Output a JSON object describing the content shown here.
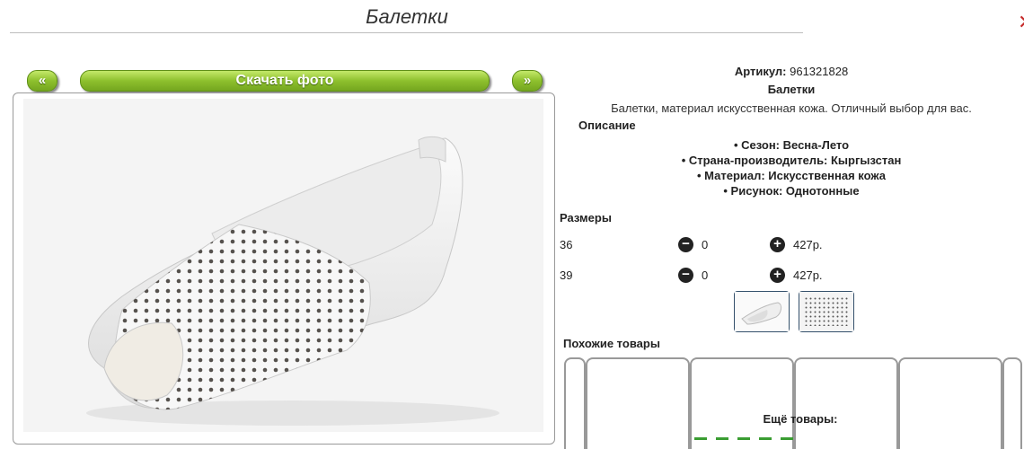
{
  "page": {
    "title": "Балетки"
  },
  "nav": {
    "prev_label": "«",
    "download_label": "Скачать фото",
    "next_label": "»"
  },
  "product": {
    "article_label": "Артикул:",
    "article_value": "961321828",
    "name": "Балетки",
    "description": "Балетки, материал искусственная кожа. Отличный выбор для вас.",
    "description_heading": "Описание",
    "specs": [
      "• Сезон: Весна-Лето",
      "• Страна-производитель: Кыргызстан",
      "• Материал: Искусственная кожа",
      "• Рисунок: Однотонные"
    ]
  },
  "sizes": {
    "heading": "Размеры",
    "rows": [
      {
        "size": "36",
        "minus": "−",
        "qty": "0",
        "plus": "+",
        "price": "427р."
      },
      {
        "size": "39",
        "minus": "−",
        "qty": "0",
        "plus": "+",
        "price": "427р."
      }
    ]
  },
  "similar": {
    "heading": "Похожие товары",
    "more_heading": "Ещё товары:"
  },
  "colors": {
    "accent_green": "#8ec02e",
    "thumb_border": "#34506b"
  }
}
